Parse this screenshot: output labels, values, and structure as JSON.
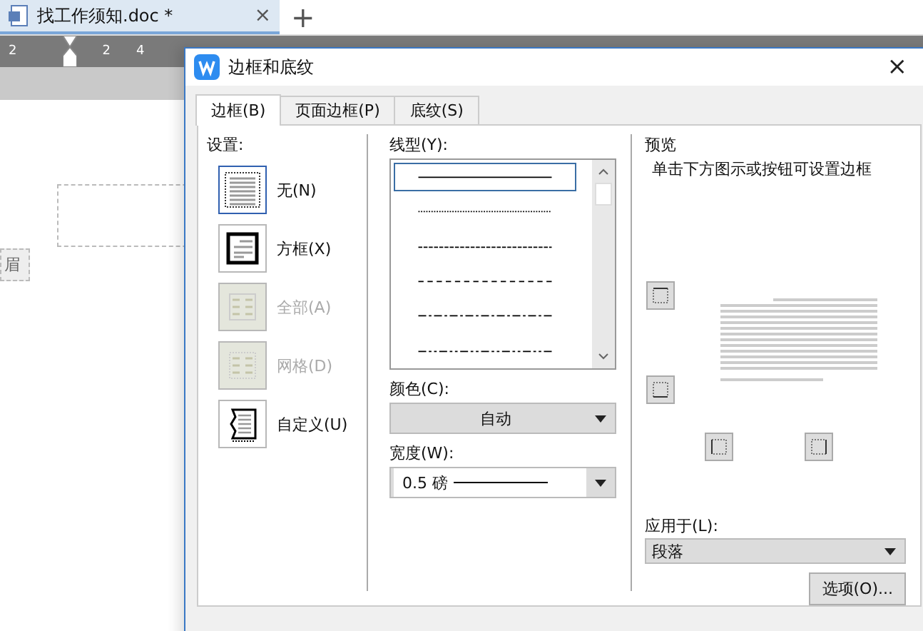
{
  "document_tab": {
    "title": "找工作须知.doc *",
    "close": "×",
    "new_tab": "+"
  },
  "ruler": {
    "numbers": [
      "2",
      "2",
      "4"
    ]
  },
  "document": {
    "header_label": "眉"
  },
  "dialog": {
    "title": "边框和底纹",
    "close": "×",
    "tabs": [
      {
        "label": "边框(B)",
        "selected": true
      },
      {
        "label": "页面边框(P)",
        "selected": false
      },
      {
        "label": "底纹(S)",
        "selected": false
      }
    ],
    "settings_label": "设置:",
    "settings": [
      {
        "kind": "none",
        "label": "无(N)",
        "selected": true,
        "disabled": false
      },
      {
        "kind": "box",
        "label": "方框(X)",
        "selected": false,
        "disabled": false
      },
      {
        "kind": "all",
        "label": "全部(A)",
        "selected": false,
        "disabled": true
      },
      {
        "kind": "grid",
        "label": "网格(D)",
        "selected": false,
        "disabled": true
      },
      {
        "kind": "custom",
        "label": "自定义(U)",
        "selected": false,
        "disabled": false
      }
    ],
    "line_style_label": "线型(Y):",
    "line_styles": [
      {
        "kind": "solid",
        "selected": true
      },
      {
        "kind": "dotted",
        "selected": false
      },
      {
        "kind": "dashed",
        "selected": false
      },
      {
        "kind": "long-dash",
        "selected": false
      },
      {
        "kind": "dash-dot",
        "selected": false
      },
      {
        "kind": "dash-dot-dot",
        "selected": false
      }
    ],
    "color_label": "颜色(C):",
    "color_value": "自动",
    "width_label": "宽度(W):",
    "width_value": "0.5 磅",
    "preview_label": "预览",
    "preview_hint": "单击下方图示或按钮可设置边框",
    "apply_label": "应用于(L):",
    "apply_value": "段落",
    "options_button": "选项(O)..."
  }
}
